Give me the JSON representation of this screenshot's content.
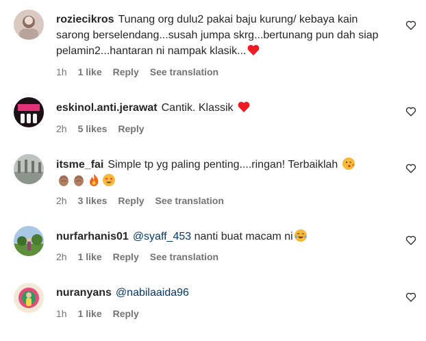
{
  "comments": [
    {
      "username": "roziecikros",
      "text": "Tunang org dulu2 pakai baju kurung/ kebaya kain sarong berselendang...susah jumpa skrg...bertunang pun dah siap pelamin2...hantaran ni nampak klasik...",
      "emoji": [
        "red-heart"
      ],
      "time": "1h",
      "likes": "1 like",
      "reply": "Reply",
      "translate": "See translation"
    },
    {
      "username": "eskinol.anti.jerawat",
      "text": "Cantik. Klassik",
      "emoji": [
        "red-heart"
      ],
      "time": "2h",
      "likes": "5 likes",
      "reply": "Reply"
    },
    {
      "username": "itsme_fai",
      "text": "Simple tp yg paling penting....ringan! Terbaiklah",
      "emoji": [
        "kissing-face",
        "clapping-hands",
        "clapping-hands",
        "fire",
        "heart-eyes-face"
      ],
      "time": "2h",
      "likes": "3 likes",
      "reply": "Reply",
      "translate": "See translation"
    },
    {
      "username": "nurfarhanis01",
      "mention": "@syaff_453",
      "text": "nanti buat macam ni",
      "emoji": [
        "tears-of-joy-face"
      ],
      "time": "2h",
      "likes": "1 like",
      "reply": "Reply",
      "translate": "See translation"
    },
    {
      "username": "nuranyans",
      "mention": "@nabilaaida96",
      "time": "1h",
      "likes": "1 like",
      "reply": "Reply"
    }
  ],
  "colors": {
    "text": "#262626",
    "meta": "#737373",
    "mention": "#00376b",
    "heart": "#ed1c24"
  },
  "icons": {
    "like": "heart-outline-icon"
  }
}
